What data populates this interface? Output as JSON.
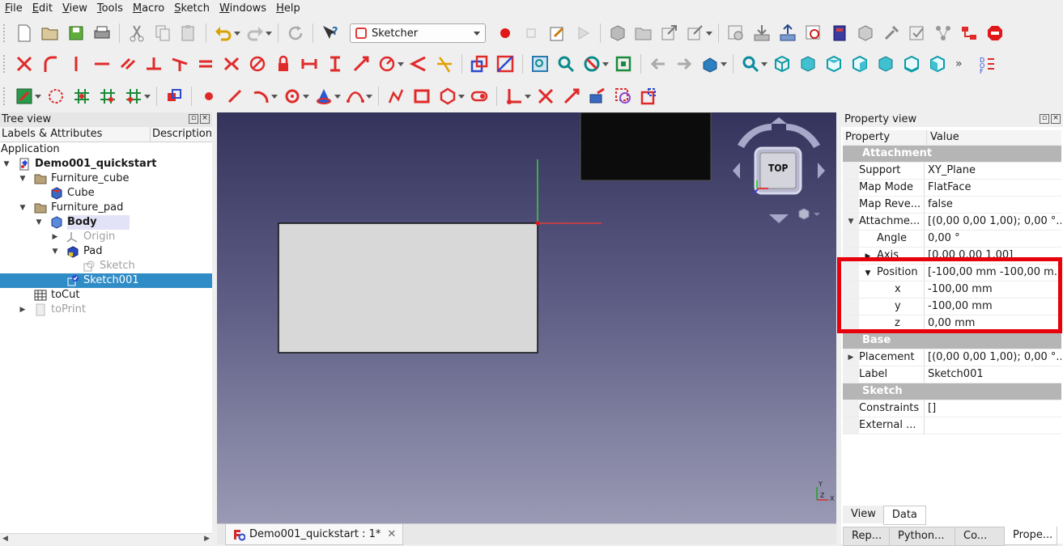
{
  "menubar": {
    "items": [
      "File",
      "Edit",
      "View",
      "Tools",
      "Macro",
      "Sketch",
      "Windows",
      "Help"
    ],
    "underline_letters": [
      "F",
      "E",
      "V",
      "T",
      "M",
      "S",
      "W",
      "H"
    ]
  },
  "toolbar": {
    "workbench": "Sketcher"
  },
  "tree_view": {
    "title": "Tree view",
    "col_labels": "Labels & Attributes",
    "col_description": "Description",
    "root": "Application",
    "items": [
      {
        "label": "Demo001_quickstart"
      },
      {
        "label": "Furniture_cube"
      },
      {
        "label": "Cube"
      },
      {
        "label": "Furniture_pad"
      },
      {
        "label": "Body"
      },
      {
        "label": "Origin"
      },
      {
        "label": "Pad"
      },
      {
        "label": "Sketch"
      },
      {
        "label": "Sketch001"
      },
      {
        "label": "toCut"
      },
      {
        "label": "toPrint"
      }
    ]
  },
  "document_tab": {
    "label": "Demo001_quickstart : 1*"
  },
  "navcube": {
    "face": "TOP"
  },
  "axis_triad": {
    "y": "Y",
    "z": "Z",
    "x": "X"
  },
  "property_view": {
    "title": "Property view",
    "col_property": "Property",
    "col_value": "Value",
    "rows": [
      {
        "name": "Attachment",
        "value": ""
      },
      {
        "name": "Support",
        "value": "XY_Plane"
      },
      {
        "name": "Map Mode",
        "value": "FlatFace"
      },
      {
        "name": "Map Reve...",
        "value": "false"
      },
      {
        "name": "Attachme...",
        "value": "[(0,00 0,00 1,00); 0,00 °..."
      },
      {
        "name": "Angle",
        "value": "0,00 °"
      },
      {
        "name": "Axis",
        "value": "[0,00 0,00 1,00]"
      },
      {
        "name": "Position",
        "value": "[-100,00 mm  -100,00 m..."
      },
      {
        "name": "x",
        "value": "-100,00 mm"
      },
      {
        "name": "y",
        "value": "-100,00 mm"
      },
      {
        "name": "z",
        "value": "0,00 mm"
      },
      {
        "name": "Base",
        "value": ""
      },
      {
        "name": "Placement",
        "value": "[(0,00 0,00 1,00); 0,00 °..."
      },
      {
        "name": "Label",
        "value": "Sketch001"
      },
      {
        "name": "Sketch",
        "value": ""
      },
      {
        "name": "Constraints",
        "value": "[]"
      },
      {
        "name": "External ...",
        "value": ""
      }
    ],
    "tab_view": "View",
    "tab_data": "Data"
  },
  "dock_tabs": [
    "Rep...",
    "Python...",
    "Co...",
    "Prope..."
  ],
  "colors": {
    "selection": "#308cc6",
    "highlight_border": "#e8000c",
    "group_row": "#b5b5b5"
  }
}
